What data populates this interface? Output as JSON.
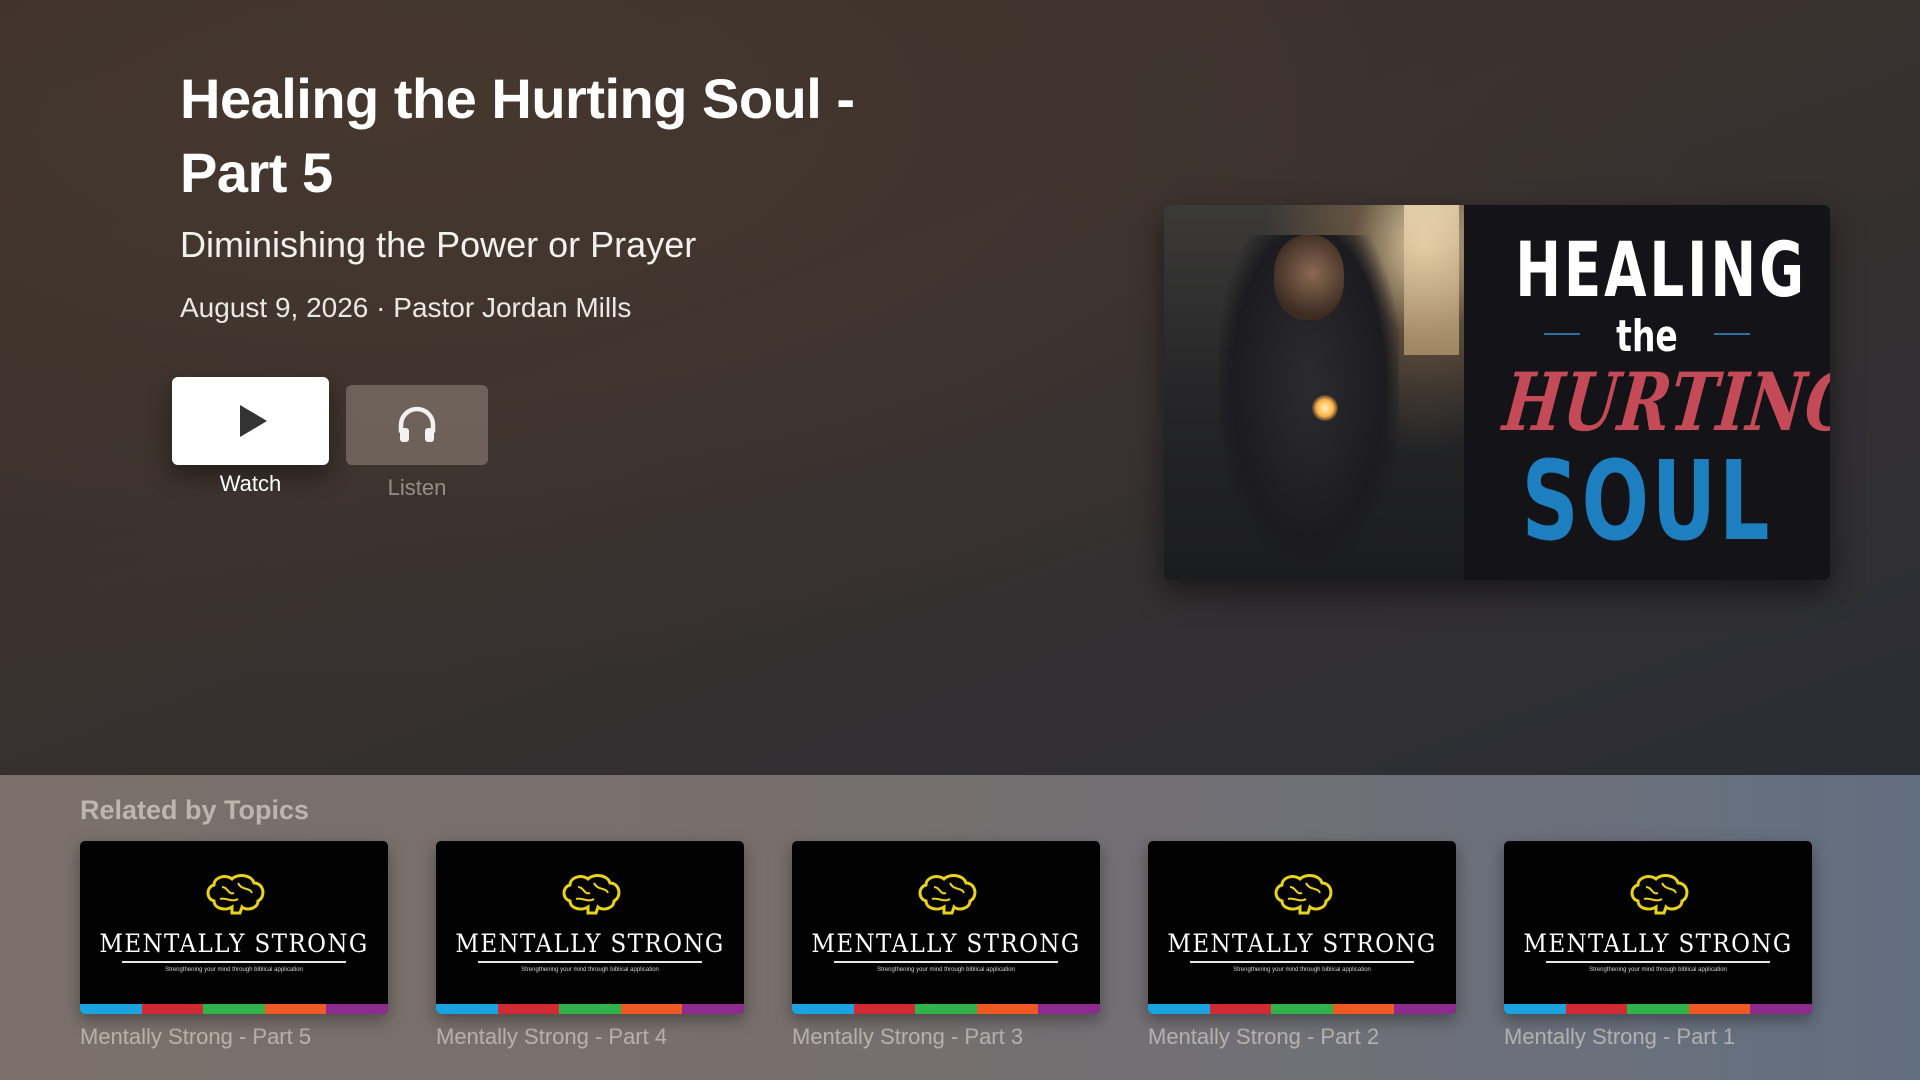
{
  "episode": {
    "title": "Healing the Hurting Soul - Part 5",
    "subtitle": "Diminishing the Power or Prayer",
    "date": "August 9, 2026",
    "separator": "·",
    "speaker": "Pastor Jordan Mills"
  },
  "actions": {
    "watch_label": "Watch",
    "watch_icon": "play-icon",
    "listen_label": "Listen",
    "listen_icon": "headphones-icon"
  },
  "artwork": {
    "line1": "HEALING",
    "line2": "the",
    "line3": "HURTING",
    "line4": "SOUL",
    "colors": {
      "healing": "#ffffff",
      "hurting": "#c44a57",
      "soul": "#1d7fc0"
    }
  },
  "related": {
    "heading": "Related by Topics",
    "items": [
      {
        "label": "Mentally Strong - Part 5",
        "brand": "MENTALLY STRONG",
        "tagline": "Strengthening your mind through biblical application"
      },
      {
        "label": "Mentally Strong - Part 4",
        "brand": "MENTALLY STRONG",
        "tagline": "Strengthening your mind through biblical application"
      },
      {
        "label": "Mentally Strong - Part 3",
        "brand": "MENTALLY STRONG",
        "tagline": "Strengthening your mind through biblical application"
      },
      {
        "label": "Mentally Strong - Part 2",
        "brand": "MENTALLY STRONG",
        "tagline": "Strengthening your mind through biblical application"
      },
      {
        "label": "Mentally Strong - Part 1",
        "brand": "MENTALLY STRONG",
        "tagline": "Strengthening your mind through biblical application"
      }
    ],
    "stripe_colors": [
      "#1aa3e0",
      "#d02a33",
      "#2fb34a",
      "#f05a22",
      "#8e2b8e"
    ],
    "brain_color": "#e8d21d"
  }
}
